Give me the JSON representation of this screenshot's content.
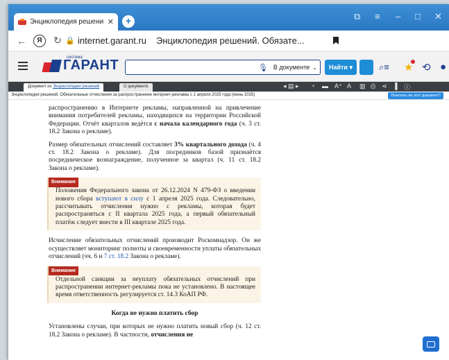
{
  "browser": {
    "tab_title": "Энциклопедия решени",
    "tab_close": "✕",
    "new_tab": "+",
    "url": "internet.garant.ru",
    "page_title": "Энциклопедия решений. Обязате..."
  },
  "garant": {
    "logo_small": "система",
    "logo_name": "ГАРАНТ",
    "search_scope": "В документе",
    "find_button": "Найти"
  },
  "doc_tabs": {
    "tab1_prefix": "Документ из ",
    "tab1_link": "Энциклопедии решений",
    "tab2": "О документе"
  },
  "doc_strip": {
    "title": "Энциклопедия решений. Обязательные отчисления за распространение интернет-рекламы с 1 апреля 2025 года (июнь 2025)",
    "question_button": "Поискать во этот документ?"
  },
  "article": {
    "p1_a": "распространению в Интернете рекламы, направленной на привлечение внимания потребителей рекламы, находящихся на территории Российской Федерации. Отчёт кварталов ведётся ",
    "p1_bold": "с начала календарного года",
    "p1_b": " (ч. 3 ст. 18.2 Закона о рекламе).",
    "p2_a": "Размер обязательных отчислений составляет ",
    "p2_bold": "3% квартального дохода",
    "p2_b": " (ч. 4 ст. 18.2 Закона о рекламе). Для посредников базой признаётся посредническое вознаграждение, полученное за квартал (ч. 11 ст. 18.2 Закона о рекламе).",
    "note1_label": "Внимание",
    "note1_a": "Положения Федерального закона от 26.12.2024 N 479-ФЗ о введении нового сбора ",
    "note1_link": "вступают в силу",
    "note1_b": " с 1 апреля 2025 года. Следовательно, рассчитывать отчисления нужно с рекламы, которая будет распространяться с II квартала 2025 года, а первый обязательный платёж следует внести в III квартале 2025 года.",
    "p3_a": "Исчисление обязательных отчислений производит Роскомнадзор. Он же осуществляет мониторинг полноты и своевременности уплаты обязательных отчислений (чч. 6 и ",
    "p3_link": "7 ст. 18.2",
    "p3_b": " Закона о рекламе).",
    "note2_label": "Внимание",
    "note2_text": "Отдельной санкции за неуплату обязательных отчислений при распространении интернет-рекламы пока не установлено. В настоящее время ответственность регулируется ст. 14.3 КоАП РФ.",
    "heading": "Когда не нужно платить сбор",
    "p4_a": "Установлены случаи, при которых не нужно платить новый сбор (ч. 12 ст. 18.2 Закона о рекламе). В частности, ",
    "p4_bold": "отчисления не"
  },
  "colors": {
    "browser_blue": "#2b78c2",
    "garant_blue": "#1b3f8f",
    "garant_red": "#d9262c",
    "note_label": "#b52a1f",
    "note_bg": "#fbf4e6"
  }
}
